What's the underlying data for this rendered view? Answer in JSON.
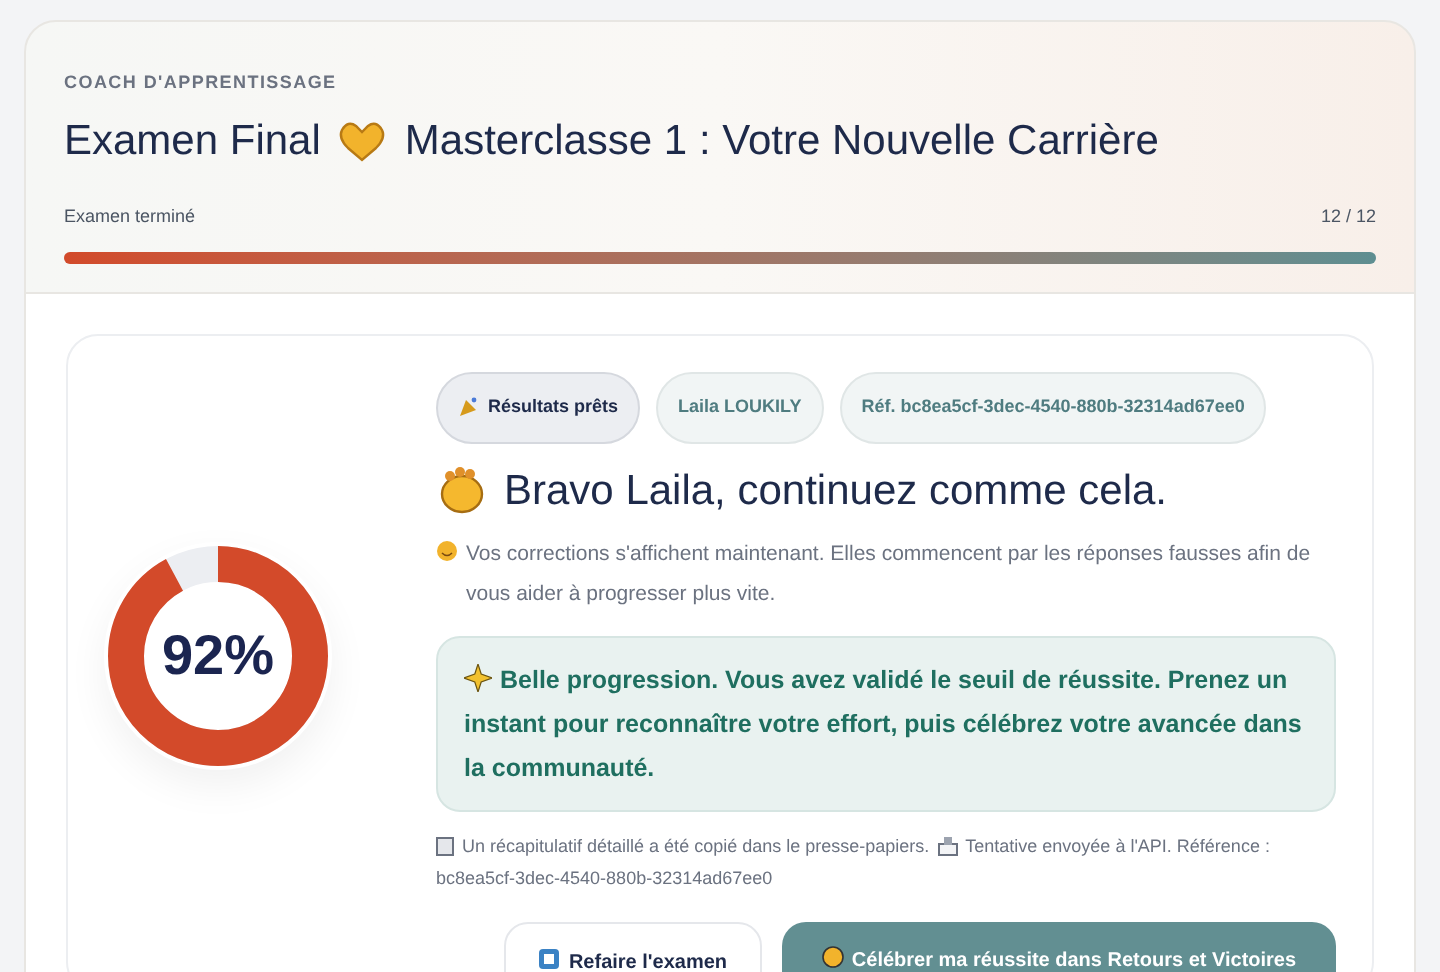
{
  "header": {
    "eyebrow": "COACH D'APPRENTISSAGE",
    "title_start": "Examen Final",
    "title_end": "Masterclasse 1 : Votre Nouvelle Carrière",
    "progress_label": "Examen terminé",
    "progress_count": "12 / 12",
    "level": 1
  },
  "result": {
    "score": "92%",
    "level": 0.92,
    "chips": [
      {
        "kind": "status",
        "label": "Résultats prêts"
      },
      {
        "kind": "plain",
        "label": "Laila LOUKILY"
      },
      {
        "kind": "plain",
        "label": "Réf. bc8ea5cf-3dec-4540-880b-32314ad67ee0"
      }
    ],
    "heading": "Bravo Laila, continuez comme cela.",
    "intro": "Vos corrections s'affichent maintenant. Elles commencent par les réponses fausses afin de vous aider à progresser plus vite.",
    "message": "Belle progression. Vous avez validé le seuil de réussite. Prenez un instant pour reconnaître votre effort, puis célébrez votre avancée dans la communauté.",
    "note_copied": "Un récapitulatif détaillé a été copié dans le presse-papiers.",
    "note_api": "Tentative envoyée à l'API. Référence :",
    "note_reference": "bc8ea5cf-3dec-4540-880b-32314ad67ee0",
    "buttons": [
      {
        "kind": "secondary",
        "label": "Refaire l'examen"
      },
      {
        "kind": "primary",
        "label": "Célébrer ma réussite dans Retours et Victoires"
      }
    ]
  }
}
